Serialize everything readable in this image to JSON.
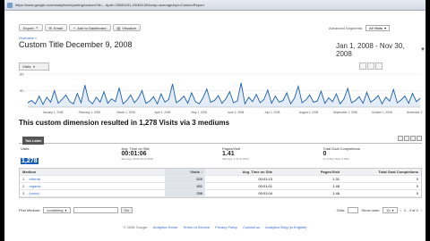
{
  "browser": {
    "url": "https://www.google.com/analytics/reporting/custom?id=...&pdr=20080101-20081130&cmp=average&rpt=CustomReport"
  },
  "toolbar": {
    "export": "Export",
    "email": "Email",
    "add_dashboard": "Add to Dashboard",
    "visualize": "Visualize"
  },
  "segments": {
    "label": "Advanced Segments:",
    "value": "All Visits"
  },
  "breadcrumb": "Overview »",
  "page_title": "Custom Title December 9, 2008",
  "date_range": "Jan 1, 2008 - Nov 30, 2008",
  "graph_mode": "Visits",
  "graph_mode_small": "Visits",
  "chart_data": {
    "type": "line",
    "y_ticks": [
      60,
      30
    ],
    "x_labels": [
      "January 1, 2008",
      "February 1, 2008",
      "March 1, 2008",
      "April 1, 2008",
      "May 1, 2008",
      "June 1, 2008",
      "July 1, 2008",
      "August 1, 2008",
      "September 1, 2008",
      "October 1, 2008",
      "November 1, 2008"
    ],
    "ylim": [
      0,
      60
    ],
    "color": "#1b5fb0",
    "values": [
      8,
      12,
      6,
      20,
      5,
      18,
      9,
      30,
      7,
      14,
      22,
      10,
      6,
      25,
      8,
      40,
      12,
      6,
      18,
      9,
      28,
      7,
      15,
      10,
      35,
      6,
      12,
      22,
      8,
      16,
      30,
      7,
      11,
      19,
      6,
      24,
      9,
      14,
      42,
      8,
      13,
      20,
      7,
      26,
      10,
      6,
      17,
      33,
      9,
      12,
      21,
      7,
      15,
      28,
      8,
      11,
      44,
      6,
      18,
      10,
      23,
      8,
      14,
      31,
      7,
      20,
      9,
      12,
      26,
      6,
      16,
      38,
      8,
      13,
      22,
      9,
      11,
      29,
      7,
      17,
      10,
      24,
      6,
      15,
      34,
      8,
      12,
      19,
      7,
      27,
      9,
      14,
      21,
      6,
      18,
      11,
      32,
      8,
      13,
      20,
      7,
      25,
      10,
      16
    ]
  },
  "summary": "This custom dimension resulted in 1,278 Visits via 3 mediums",
  "tab_label": "Tab Label",
  "metrics": [
    {
      "label": "Visits",
      "value": "1,278",
      "sub": "% of Site Total: 100.00%"
    },
    {
      "label": "Avg. Time on Site",
      "value": "00:01:06",
      "sub": "Site Avg: 00:01:06 (0.00%)"
    },
    {
      "label": "Pages/Visit",
      "value": "1.41",
      "sub": "Site Avg: 1.41 (0.00%)"
    },
    {
      "label": "Total Goal Completions",
      "value": "0",
      "sub": "% of Site Total: 0.00%"
    }
  ],
  "table": {
    "headers": [
      "Medium",
      "Visits ↓",
      "Avg. Time on Site",
      "Pages/Visit",
      "Total Goal Completions"
    ],
    "rows": [
      {
        "num": "1.",
        "name": "referral",
        "visits": "529",
        "time": "00:01:13",
        "ppv": "1.31",
        "goals": "0"
      },
      {
        "num": "2.",
        "name": "organic",
        "visits": "451",
        "time": "00:01:01",
        "ppv": "1.48",
        "goals": "0"
      },
      {
        "num": "3.",
        "name": "(none)",
        "visits": "298",
        "time": "00:01:04",
        "ppv": "1.46",
        "goals": "0"
      }
    ]
  },
  "filter": {
    "label": "Find Medium:",
    "mode": "containing",
    "go": "Go",
    "goto": "Goto:",
    "show_rows": "Show rows:",
    "rows_value": "10",
    "range": "1 - 3 of 3"
  },
  "footer": {
    "copyright": "© 2008 Google",
    "links": [
      "Analytics Home",
      "Terms of Service",
      "Privacy Policy",
      "Contact us",
      "Analytics Blog (in English)"
    ]
  }
}
